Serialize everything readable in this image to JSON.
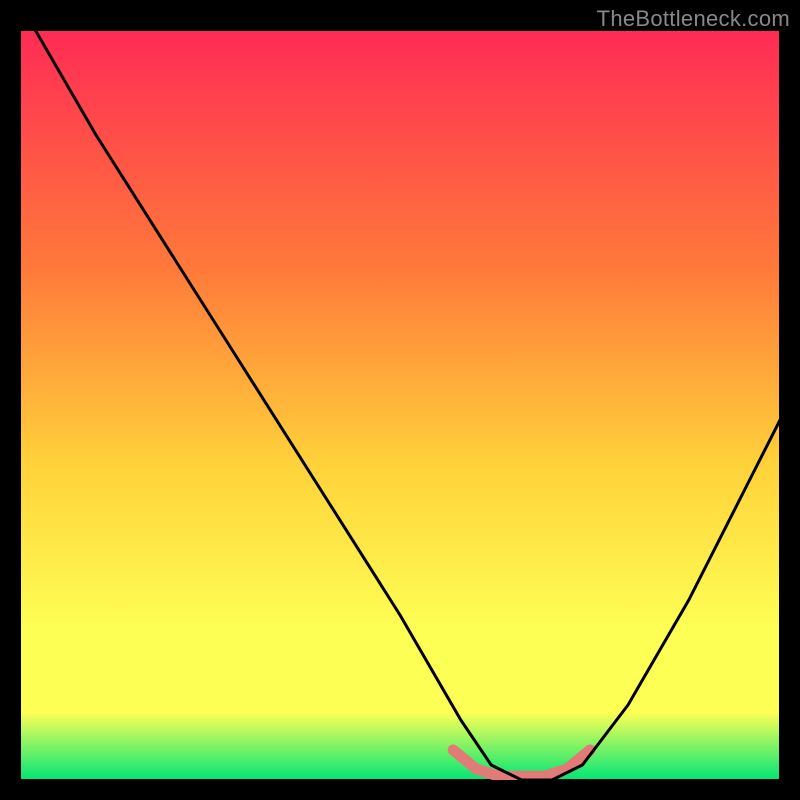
{
  "watermark": "TheBottleneck.com",
  "colors": {
    "frame": "#000000",
    "grad_top": "#ff2b55",
    "grad_mid1": "#ff7a3a",
    "grad_mid2": "#ffd23a",
    "grad_mid3": "#feff55",
    "grad_bottom": "#00e676",
    "curve": "#000000",
    "accent": "#e27b78"
  },
  "chart_data": {
    "type": "line",
    "title": "",
    "xlabel": "",
    "ylabel": "",
    "xlim": [
      0,
      100
    ],
    "ylim": [
      0,
      100
    ],
    "series": [
      {
        "name": "bottleneck-curve",
        "x": [
          2,
          10,
          20,
          30,
          40,
          50,
          58,
          62,
          66,
          70,
          74,
          80,
          88,
          96,
          100
        ],
        "y": [
          100,
          86,
          70,
          54,
          38,
          22,
          8,
          2,
          0,
          0,
          2,
          10,
          24,
          40,
          48
        ]
      }
    ],
    "accent_segment": {
      "name": "optimal-region",
      "x": [
        57,
        60,
        63,
        66,
        69,
        72,
        75
      ],
      "y": [
        4,
        1.5,
        0.5,
        0.5,
        0.5,
        1.5,
        4
      ]
    }
  }
}
